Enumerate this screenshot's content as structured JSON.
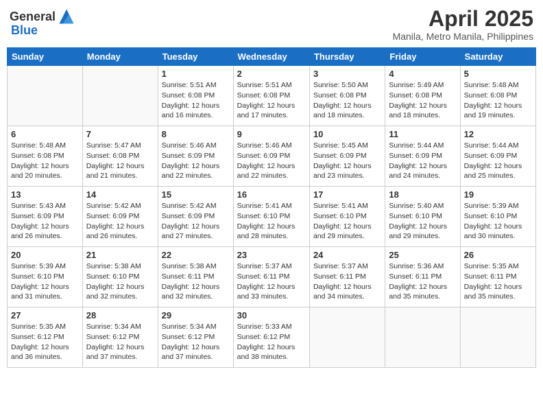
{
  "header": {
    "logo_general": "General",
    "logo_blue": "Blue",
    "month": "April 2025",
    "location": "Manila, Metro Manila, Philippines"
  },
  "weekdays": [
    "Sunday",
    "Monday",
    "Tuesday",
    "Wednesday",
    "Thursday",
    "Friday",
    "Saturday"
  ],
  "weeks": [
    [
      {
        "day": "",
        "info": ""
      },
      {
        "day": "",
        "info": ""
      },
      {
        "day": "1",
        "info": "Sunrise: 5:51 AM\nSunset: 6:08 PM\nDaylight: 12 hours and 16 minutes."
      },
      {
        "day": "2",
        "info": "Sunrise: 5:51 AM\nSunset: 6:08 PM\nDaylight: 12 hours and 17 minutes."
      },
      {
        "day": "3",
        "info": "Sunrise: 5:50 AM\nSunset: 6:08 PM\nDaylight: 12 hours and 18 minutes."
      },
      {
        "day": "4",
        "info": "Sunrise: 5:49 AM\nSunset: 6:08 PM\nDaylight: 12 hours and 18 minutes."
      },
      {
        "day": "5",
        "info": "Sunrise: 5:48 AM\nSunset: 6:08 PM\nDaylight: 12 hours and 19 minutes."
      }
    ],
    [
      {
        "day": "6",
        "info": "Sunrise: 5:48 AM\nSunset: 6:08 PM\nDaylight: 12 hours and 20 minutes."
      },
      {
        "day": "7",
        "info": "Sunrise: 5:47 AM\nSunset: 6:08 PM\nDaylight: 12 hours and 21 minutes."
      },
      {
        "day": "8",
        "info": "Sunrise: 5:46 AM\nSunset: 6:09 PM\nDaylight: 12 hours and 22 minutes."
      },
      {
        "day": "9",
        "info": "Sunrise: 5:46 AM\nSunset: 6:09 PM\nDaylight: 12 hours and 22 minutes."
      },
      {
        "day": "10",
        "info": "Sunrise: 5:45 AM\nSunset: 6:09 PM\nDaylight: 12 hours and 23 minutes."
      },
      {
        "day": "11",
        "info": "Sunrise: 5:44 AM\nSunset: 6:09 PM\nDaylight: 12 hours and 24 minutes."
      },
      {
        "day": "12",
        "info": "Sunrise: 5:44 AM\nSunset: 6:09 PM\nDaylight: 12 hours and 25 minutes."
      }
    ],
    [
      {
        "day": "13",
        "info": "Sunrise: 5:43 AM\nSunset: 6:09 PM\nDaylight: 12 hours and 26 minutes."
      },
      {
        "day": "14",
        "info": "Sunrise: 5:42 AM\nSunset: 6:09 PM\nDaylight: 12 hours and 26 minutes."
      },
      {
        "day": "15",
        "info": "Sunrise: 5:42 AM\nSunset: 6:09 PM\nDaylight: 12 hours and 27 minutes."
      },
      {
        "day": "16",
        "info": "Sunrise: 5:41 AM\nSunset: 6:10 PM\nDaylight: 12 hours and 28 minutes."
      },
      {
        "day": "17",
        "info": "Sunrise: 5:41 AM\nSunset: 6:10 PM\nDaylight: 12 hours and 29 minutes."
      },
      {
        "day": "18",
        "info": "Sunrise: 5:40 AM\nSunset: 6:10 PM\nDaylight: 12 hours and 29 minutes."
      },
      {
        "day": "19",
        "info": "Sunrise: 5:39 AM\nSunset: 6:10 PM\nDaylight: 12 hours and 30 minutes."
      }
    ],
    [
      {
        "day": "20",
        "info": "Sunrise: 5:39 AM\nSunset: 6:10 PM\nDaylight: 12 hours and 31 minutes."
      },
      {
        "day": "21",
        "info": "Sunrise: 5:38 AM\nSunset: 6:10 PM\nDaylight: 12 hours and 32 minutes."
      },
      {
        "day": "22",
        "info": "Sunrise: 5:38 AM\nSunset: 6:11 PM\nDaylight: 12 hours and 32 minutes."
      },
      {
        "day": "23",
        "info": "Sunrise: 5:37 AM\nSunset: 6:11 PM\nDaylight: 12 hours and 33 minutes."
      },
      {
        "day": "24",
        "info": "Sunrise: 5:37 AM\nSunset: 6:11 PM\nDaylight: 12 hours and 34 minutes."
      },
      {
        "day": "25",
        "info": "Sunrise: 5:36 AM\nSunset: 6:11 PM\nDaylight: 12 hours and 35 minutes."
      },
      {
        "day": "26",
        "info": "Sunrise: 5:35 AM\nSunset: 6:11 PM\nDaylight: 12 hours and 35 minutes."
      }
    ],
    [
      {
        "day": "27",
        "info": "Sunrise: 5:35 AM\nSunset: 6:12 PM\nDaylight: 12 hours and 36 minutes."
      },
      {
        "day": "28",
        "info": "Sunrise: 5:34 AM\nSunset: 6:12 PM\nDaylight: 12 hours and 37 minutes."
      },
      {
        "day": "29",
        "info": "Sunrise: 5:34 AM\nSunset: 6:12 PM\nDaylight: 12 hours and 37 minutes."
      },
      {
        "day": "30",
        "info": "Sunrise: 5:33 AM\nSunset: 6:12 PM\nDaylight: 12 hours and 38 minutes."
      },
      {
        "day": "",
        "info": ""
      },
      {
        "day": "",
        "info": ""
      },
      {
        "day": "",
        "info": ""
      }
    ]
  ]
}
